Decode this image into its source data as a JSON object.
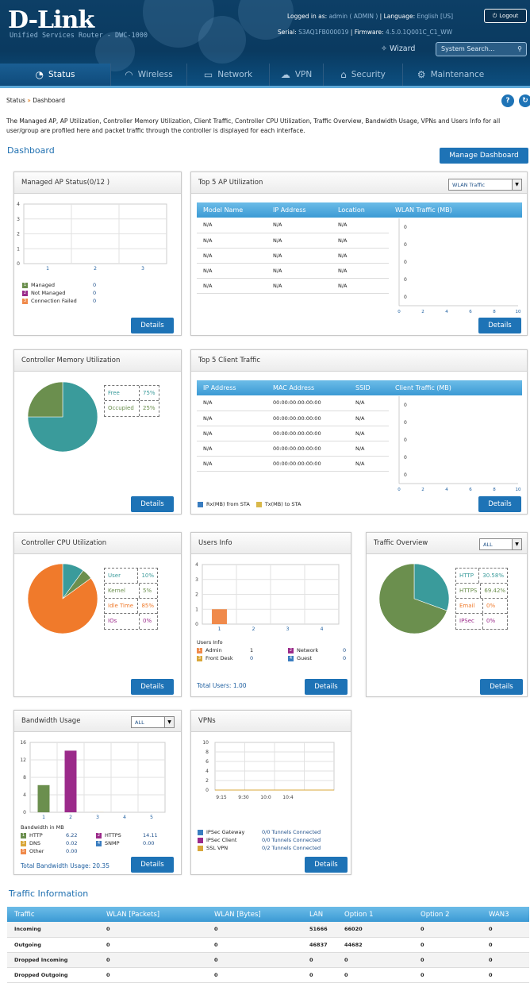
{
  "header": {
    "logo": "D-Link",
    "subtitle": "Unified Services Router - DWC-1000",
    "logged_label": "Logged in as:",
    "logged_value": "admin ( ADMIN )",
    "language_label": "Language:",
    "language_value": "English [US]",
    "serial_label": "Serial:",
    "serial_value": "S3AQ1FB000019",
    "firmware_label": "Firmware:",
    "firmware_value": "4.5.0.1Q001C_C1_WW",
    "logout": "Logout",
    "wizard": "Wizard",
    "search_placeholder": "System Search..."
  },
  "nav": [
    {
      "label": "Status",
      "icon": "gauge-icon"
    },
    {
      "label": "Wireless",
      "icon": "wifi-icon"
    },
    {
      "label": "Network",
      "icon": "monitor-icon"
    },
    {
      "label": "VPN",
      "icon": "cloud-icon"
    },
    {
      "label": "Security",
      "icon": "lock-icon"
    },
    {
      "label": "Maintenance",
      "icon": "gears-icon"
    }
  ],
  "breadcrumb": {
    "root": "Status",
    "sep": "»",
    "current": "Dashboard"
  },
  "description": "The Managed AP, AP Utilization, Controller Memory Utilization, Client Traffic, Controller CPU Utilization, Traffic Overview, Bandwidth Usage, VPNs and Users Info for all user/group are profiled here and packet traffic through the controller is displayed for each interface.",
  "dashboard_title": "Dashboard",
  "manage_dashboard": "Manage Dashboard",
  "details_label": "Details",
  "managed_ap": {
    "title": "Managed AP Status(0/12 )",
    "y_ticks": [
      "4",
      "3",
      "2",
      "1",
      "0"
    ],
    "x_ticks": [
      "1",
      "2",
      "3"
    ],
    "legend": [
      {
        "n": "1",
        "label": "Managed",
        "value": "0",
        "color": "#6b8f4e"
      },
      {
        "n": "2",
        "label": "Not Managed",
        "value": "0",
        "color": "#9b2a8a"
      },
      {
        "n": "3",
        "label": "Connection Failed",
        "value": "0",
        "color": "#f08a4b"
      }
    ]
  },
  "top5ap": {
    "title": "Top 5 AP Utilization",
    "select": "WLAN Traffic",
    "headers": [
      "Model Name",
      "IP Address",
      "Location",
      "WLAN Traffic (MB)"
    ],
    "rows": [
      [
        "N/A",
        "N/A",
        "N/A"
      ],
      [
        "N/A",
        "N/A",
        "N/A"
      ],
      [
        "N/A",
        "N/A",
        "N/A"
      ],
      [
        "N/A",
        "N/A",
        "N/A"
      ],
      [
        "N/A",
        "N/A",
        "N/A"
      ]
    ],
    "bar_values": [
      "0",
      "0",
      "0",
      "0",
      "0"
    ],
    "x_ticks": [
      "0",
      "2",
      "4",
      "6",
      "8",
      "10"
    ]
  },
  "memory": {
    "title": "Controller Memory Utilization",
    "rows": [
      {
        "label": "Free",
        "value": "75%",
        "color": "#3a9b9b"
      },
      {
        "label": "Occupied",
        "value": "25%",
        "color": "#6b8f4e"
      }
    ]
  },
  "top5client": {
    "title": "Top 5 Client Traffic",
    "headers": [
      "IP Address",
      "MAC Address",
      "SSID",
      "Client Traffic (MB)"
    ],
    "rows": [
      [
        "N/A",
        "00:00:00:00:00:00",
        "N/A"
      ],
      [
        "N/A",
        "00:00:00:00:00:00",
        "N/A"
      ],
      [
        "N/A",
        "00:00:00:00:00:00",
        "N/A"
      ],
      [
        "N/A",
        "00:00:00:00:00:00",
        "N/A"
      ],
      [
        "N/A",
        "00:00:00:00:00:00",
        "N/A"
      ]
    ],
    "bar_values": [
      "0",
      "0",
      "0",
      "0",
      "0"
    ],
    "x_ticks": [
      "0",
      "2",
      "4",
      "6",
      "8",
      "10"
    ],
    "legend_rx": "Rx(MB) from STA",
    "legend_tx": "Tx(MB) to STA"
  },
  "cpu": {
    "title": "Controller CPU Utilization",
    "rows": [
      {
        "label": "User",
        "value": "10%",
        "color": "#3a9b9b"
      },
      {
        "label": "Kernel",
        "value": "5%",
        "color": "#6b8f4e"
      },
      {
        "label": "Idle Time",
        "value": "85%",
        "color": "#f07a2b"
      },
      {
        "label": "IOs",
        "value": "0%",
        "color": "#9b2a8a"
      }
    ]
  },
  "users": {
    "title": "Users Info",
    "y_ticks": [
      "4",
      "3",
      "2",
      "1",
      "0"
    ],
    "x_ticks": [
      "1",
      "2",
      "3",
      "4"
    ],
    "sublabel": "Users Info",
    "legend": [
      {
        "n": "1",
        "label": "Admin",
        "value": "1",
        "color": "#f08a4b"
      },
      {
        "n": "2",
        "label": "Network",
        "value": "0",
        "color": "#9b2a8a"
      },
      {
        "n": "3",
        "label": "Front Desk",
        "value": "0",
        "color": "#d9a73a"
      },
      {
        "n": "4",
        "label": "Guest",
        "value": "0",
        "color": "#3a7dc0"
      }
    ],
    "total": "Total Users: 1.00"
  },
  "traffic_overview": {
    "title": "Traffic Overview",
    "select": "ALL",
    "rows": [
      {
        "label": "HTTP",
        "value": "30.58%",
        "color": "#3a9b9b"
      },
      {
        "label": "HTTPS",
        "value": "69.42%",
        "color": "#6b8f4e"
      },
      {
        "label": "Email",
        "value": "0%",
        "color": "#f07a2b"
      },
      {
        "label": "IPSec",
        "value": "0%",
        "color": "#9b2a8a"
      }
    ]
  },
  "bandwidth": {
    "title": "Bandwidth Usage",
    "select": "ALL",
    "y_ticks": [
      "16",
      "12",
      "8",
      "4",
      "0"
    ],
    "x_ticks": [
      "1",
      "2",
      "3",
      "4",
      "5"
    ],
    "unit_label": "Bandwidth in MB",
    "legend": [
      {
        "n": "1",
        "label": "HTTP",
        "value": "6.22",
        "color": "#6b8f4e"
      },
      {
        "n": "2",
        "label": "HTTPS",
        "value": "14.11",
        "color": "#9b2a8a"
      },
      {
        "n": "3",
        "label": "DNS",
        "value": "0.02",
        "color": "#d9a73a"
      },
      {
        "n": "4",
        "label": "SNMP",
        "value": "0.00",
        "color": "#3a7dc0"
      },
      {
        "n": "5",
        "label": "Other",
        "value": "0.00",
        "color": "#f08a4b"
      }
    ],
    "total": "Total Bandwidth Usage: 20.35"
  },
  "vpns": {
    "title": "VPNs",
    "y_ticks": [
      "10",
      "8",
      "6",
      "4",
      "2",
      "0"
    ],
    "x_ticks": [
      "9:15",
      "9:30",
      "10:0",
      "10:4"
    ],
    "legend": [
      {
        "label": "IPSec Gateway",
        "value": "0/0 Tunnels Connected",
        "color": "#3a7dc0"
      },
      {
        "label": "IPSec Client",
        "value": "0/0 Tunnels Connected",
        "color": "#9b2a8a"
      },
      {
        "label": "SSL VPN",
        "value": "0/2 Tunnels Connected",
        "color": "#d9a73a"
      }
    ]
  },
  "traffic_info": {
    "title": "Traffic Information",
    "headers": [
      "Traffic",
      "WLAN [Packets]",
      "WLAN [Bytes]",
      "LAN",
      "Option 1",
      "Option 2",
      "WAN3"
    ],
    "rows": [
      [
        "Incoming",
        "0",
        "0",
        "51666",
        "66020",
        "0",
        "0"
      ],
      [
        "Outgoing",
        "0",
        "0",
        "46837",
        "44682",
        "0",
        "0"
      ],
      [
        "Dropped Incoming",
        "0",
        "0",
        "0",
        "0",
        "0",
        "0"
      ],
      [
        "Dropped Outgoing",
        "0",
        "0",
        "0",
        "0",
        "0",
        "0"
      ]
    ]
  },
  "chart_data": [
    {
      "type": "bar",
      "title": "Managed AP Status(0/12 )",
      "categories": [
        "1",
        "2",
        "3"
      ],
      "values": [
        0,
        0,
        0
      ],
      "ylim": [
        0,
        4
      ]
    },
    {
      "type": "bar",
      "title": "Top 5 AP Utilization",
      "orientation": "horizontal",
      "values": [
        0,
        0,
        0,
        0,
        0
      ],
      "xlim": [
        0,
        10
      ]
    },
    {
      "type": "pie",
      "title": "Controller Memory Utilization",
      "categories": [
        "Free",
        "Occupied"
      ],
      "values": [
        75,
        25
      ]
    },
    {
      "type": "bar",
      "title": "Top 5 Client Traffic",
      "orientation": "horizontal",
      "series": [
        {
          "name": "Rx(MB) from STA",
          "values": [
            0,
            0,
            0,
            0,
            0
          ]
        },
        {
          "name": "Tx(MB) to STA",
          "values": [
            0,
            0,
            0,
            0,
            0
          ]
        }
      ],
      "xlim": [
        0,
        10
      ]
    },
    {
      "type": "pie",
      "title": "Controller CPU Utilization",
      "categories": [
        "User",
        "Kernel",
        "Idle Time",
        "IOs"
      ],
      "values": [
        10,
        5,
        85,
        0
      ]
    },
    {
      "type": "bar",
      "title": "Users Info",
      "categories": [
        "1",
        "2",
        "3",
        "4"
      ],
      "values": [
        1,
        0,
        0,
        0
      ],
      "ylim": [
        0,
        4
      ]
    },
    {
      "type": "pie",
      "title": "Traffic Overview",
      "categories": [
        "HTTP",
        "HTTPS",
        "Email",
        "IPSec"
      ],
      "values": [
        30.58,
        69.42,
        0,
        0
      ]
    },
    {
      "type": "bar",
      "title": "Bandwidth Usage",
      "categories": [
        "1",
        "2",
        "3",
        "4",
        "5"
      ],
      "values": [
        6.22,
        14.11,
        0.02,
        0,
        0
      ],
      "ylim": [
        0,
        16
      ]
    },
    {
      "type": "line",
      "title": "VPNs",
      "x": [
        "9:15",
        "9:30",
        "10:0",
        "10:4"
      ],
      "series": [
        {
          "name": "IPSec Gateway",
          "values": [
            0,
            0,
            0,
            0
          ]
        },
        {
          "name": "IPSec Client",
          "values": [
            0,
            0,
            0,
            0
          ]
        },
        {
          "name": "SSL VPN",
          "values": [
            0,
            0,
            0,
            0
          ]
        }
      ],
      "ylim": [
        0,
        10
      ]
    }
  ]
}
